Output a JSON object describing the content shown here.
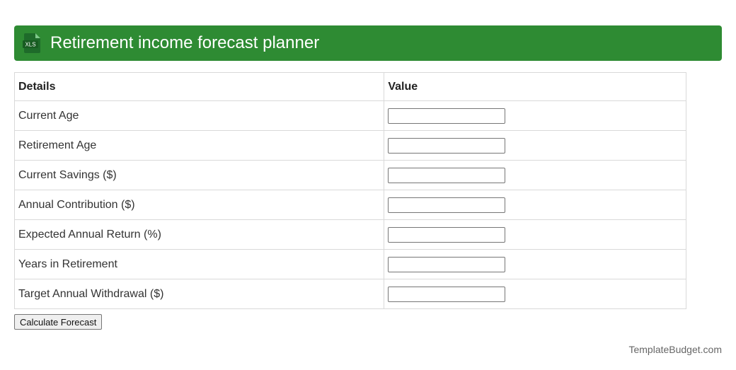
{
  "header": {
    "icon": "xls-file-icon",
    "icon_label": "XLS",
    "title": "Retirement income forecast planner",
    "color": "#2e8b33"
  },
  "table": {
    "headers": [
      "Details",
      "Value"
    ],
    "rows": [
      {
        "label": "Current Age",
        "value": ""
      },
      {
        "label": "Retirement Age",
        "value": ""
      },
      {
        "label": "Current Savings ($)",
        "value": ""
      },
      {
        "label": "Annual Contribution ($)",
        "value": ""
      },
      {
        "label": "Expected Annual Return (%)",
        "value": ""
      },
      {
        "label": "Years in Retirement",
        "value": ""
      },
      {
        "label": "Target Annual Withdrawal ($)",
        "value": ""
      }
    ]
  },
  "actions": {
    "calculate_label": "Calculate Forecast"
  },
  "footer": {
    "brand": "TemplateBudget.com"
  }
}
